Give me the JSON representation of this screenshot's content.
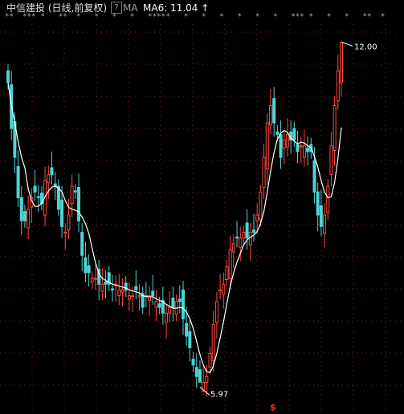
{
  "header": {
    "stock_name": "中信建投",
    "period": "(日线,前复权)",
    "help_icon": "?",
    "indicator": "MA",
    "ma_label": "MA6: 11.04",
    "arrow_up": "↑"
  },
  "event_markers": [
    "**",
    "***",
    "*",
    "**",
    "*",
    "*",
    "*",
    "*",
    "****",
    "*",
    "*",
    "*",
    "*",
    "*",
    "*",
    "*",
    "***",
    "*",
    "*",
    "*",
    "**",
    "*"
  ],
  "bottom_marker": "$",
  "colors": {
    "up": "#ff4a3d",
    "down": "#4fd4d4",
    "ma": "#ffffff",
    "grid": "#8a2020",
    "price_label": "#ffffff",
    "marker": "#ff2a2a"
  },
  "chart_data": {
    "type": "candlestick",
    "high_label": "12.00",
    "low_label": "5.97",
    "ylim": [
      5.8,
      12.2
    ],
    "closes": [
      11.3,
      10.5,
      10.0,
      9.3,
      8.9,
      8.9,
      9.1,
      9.3,
      9.4,
      9.3,
      9.2,
      9.6,
      9.7,
      9.7,
      9.5,
      9.1,
      8.8,
      8.7,
      9.0,
      9.5,
      9.4,
      8.9,
      8.3,
      8.0,
      8.0,
      7.9,
      7.9,
      7.8,
      7.8,
      7.8,
      7.8,
      7.7,
      7.8,
      7.7,
      7.7,
      7.7,
      7.6,
      7.6,
      7.7,
      7.6,
      7.4,
      7.6,
      7.6,
      7.6,
      7.5,
      7.4,
      7.3,
      7.3,
      7.4,
      7.4,
      7.5,
      7.5,
      7.2,
      6.9,
      6.7,
      6.4,
      6.2,
      6.1,
      6.1,
      6.2,
      6.6,
      7.1,
      7.5,
      7.7,
      7.8,
      8.1,
      8.4,
      8.5,
      8.6,
      8.6,
      8.7,
      8.6,
      8.7,
      8.7,
      9.0,
      9.4,
      10.0,
      10.6,
      10.9,
      10.6,
      10.4,
      10.0,
      10.3,
      10.4,
      10.3,
      10.3,
      10.1,
      10.2,
      10.2,
      10.1,
      10.1,
      9.4,
      9.0,
      8.8,
      9.0,
      9.5,
      10.2,
      10.9,
      11.5,
      12.0
    ]
  }
}
